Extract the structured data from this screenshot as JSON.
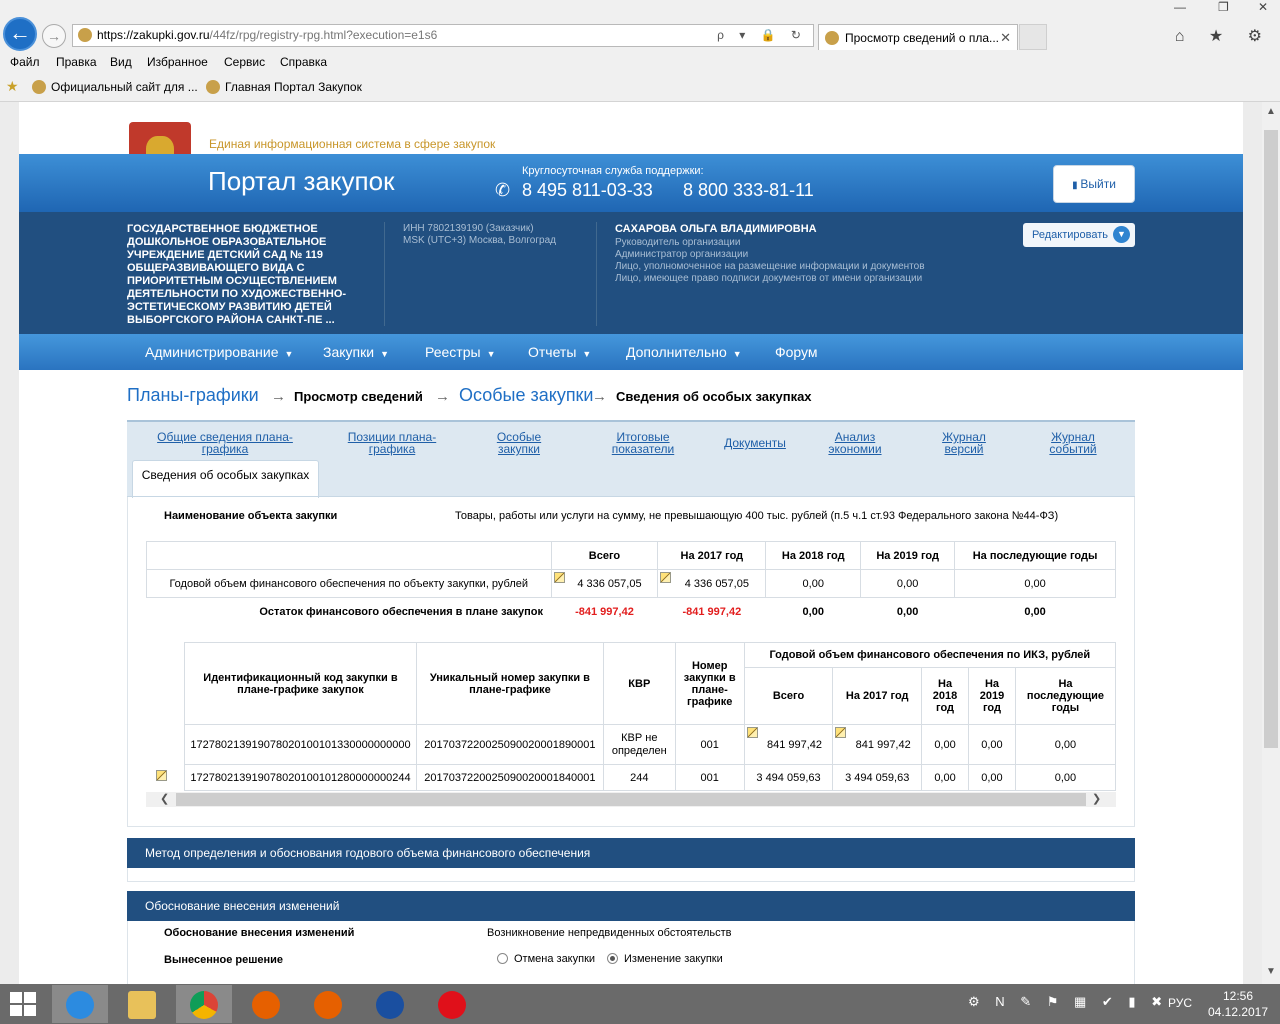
{
  "browser": {
    "url_host": "https://zakupki.gov.ru",
    "url_path": "/44fz/rpg/registry-rpg.html?execution=e1s6",
    "address_tools": "ρ ▾ 🔒 ↻",
    "tab_title": "Просмотр сведений о пла...",
    "tab_close": "✕",
    "back": "←",
    "forward": "→",
    "nav_icons": "⌂ ★ ⚙",
    "window_controls": [
      "—",
      "❐",
      "✕"
    ],
    "menu": [
      "Файл",
      "Правка",
      "Вид",
      "Избранное",
      "Сервис",
      "Справка"
    ],
    "favorites": [
      "Официальный сайт для ...",
      "Главная Портал Закупок"
    ]
  },
  "header": {
    "eis_title": "Единая информационная система в сфере закупок",
    "portal_title": "Портал закупок",
    "support_label": "Круглосуточная служба поддержки:",
    "phone1": "8 495 811-03-33",
    "phone2": "8 800 333-81-11",
    "logout": "Выйти"
  },
  "org": {
    "name": "ГОСУДАРСТВЕННОЕ БЮДЖЕТНОЕ ДОШКОЛЬНОЕ ОБРАЗОВАТЕЛЬНОЕ УЧРЕЖДЕНИЕ ДЕТСКИЙ САД № 119 ОБЩЕРАЗВИВАЮЩЕГО ВИДА С ПРИОРИТЕТНЫМ ОСУЩЕСТВЛЕНИЕМ ДЕЯТЕЛЬНОСТИ ПО ХУДОЖЕСТВЕННО-ЭСТЕТИЧЕСКОМУ РАЗВИТИЮ ДЕТЕЙ ВЫБОРГСКОГО РАЙОНА САНКТ-ПЕ ...",
    "inn": "ИНН 7802139190 (Заказчик)",
    "tz": "MSK (UTC+3) Москва, Волгоград",
    "user_name": "САХАРОВА ОЛЬГА ВЛАДИМИРОВНА",
    "roles": [
      "Руководитель организации",
      "Администратор организации",
      "Лицо, уполномоченное на размещение информации и документов",
      "Лицо, имеющее право подписи документов от имени организации"
    ],
    "edit": "Редактировать"
  },
  "nav": [
    "Администрирование",
    "Закупки",
    "Реестры",
    "Отчеты",
    "Дополнительно",
    "Форум"
  ],
  "breadcrumb": [
    "Планы-графики",
    "Просмотр сведений",
    "Особые закупки",
    "Сведения об особых закупках"
  ],
  "tabs": [
    "Общие сведения плана-графика",
    "Позиции плана-графика",
    "Особые закупки",
    "Итоговые показатели",
    "Документы",
    "Анализ экономии",
    "Журнал версий",
    "Журнал событий"
  ],
  "tab_current": "Сведения об особых закупках",
  "object": {
    "label": "Наименование объекта закупки",
    "value": "Товары, работы или услуги на сумму, не превышающую 400 тыс. рублей (п.5 ч.1 ст.93 Федерального закона №44-ФЗ)"
  },
  "fin": {
    "headers": [
      "Всего",
      "На 2017 год",
      "На 2018 год",
      "На 2019 год",
      "На последующие годы"
    ],
    "row_label": "Годовой объем финансового обеспечения по объекту закупки, рублей",
    "row_values": [
      "4 336 057,05",
      "4 336 057,05",
      "0,00",
      "0,00",
      "0,00"
    ],
    "rest_label": "Остаток финансового обеспечения в плане закупок",
    "rest_values": [
      "-841 997,42",
      "-841 997,42",
      "0,00",
      "0,00",
      "0,00"
    ]
  },
  "ikz": {
    "h_code": "Идентификационный код закупки в плане-графике закупок",
    "h_uniq": "Уникальный номер закупки в плане-графике",
    "h_kvr": "КВР",
    "h_num": "Номер закупки в плане-графике",
    "h_group": "Годовой объем финансового обеспечения по ИКЗ, рублей",
    "h_sub": [
      "Всего",
      "На 2017 год",
      "На 2018 год",
      "На 2019 год",
      "На последующие годы"
    ],
    "rows": [
      {
        "code": "172780213919078020100101330000000000",
        "uniq": "2017037220025090020001890001",
        "kvr": "КВР не определен",
        "num": "001",
        "vals": [
          "841 997,42",
          "841 997,42",
          "0,00",
          "0,00",
          "0,00"
        ]
      },
      {
        "code": "172780213919078020100101280000000244",
        "uniq": "2017037220025090020001840001",
        "kvr": "244",
        "num": "001",
        "vals": [
          "3 494 059,63",
          "3 494 059,63",
          "0,00",
          "0,00",
          "0,00"
        ]
      }
    ]
  },
  "section_method": "Метод определения и обоснования годового объема финансового обеспечения",
  "section_change": "Обоснование внесения изменений",
  "change": {
    "reason_label": "Обоснование внесения изменений",
    "reason_value": "Возникновение непредвиденных обстоятельств",
    "decision_label": "Вынесенное решение",
    "opt1": "Отмена закупки",
    "opt2": "Изменение закупки"
  },
  "taskbar": {
    "lang": "РУС",
    "time": "12:56",
    "date": "04.12.2017"
  }
}
